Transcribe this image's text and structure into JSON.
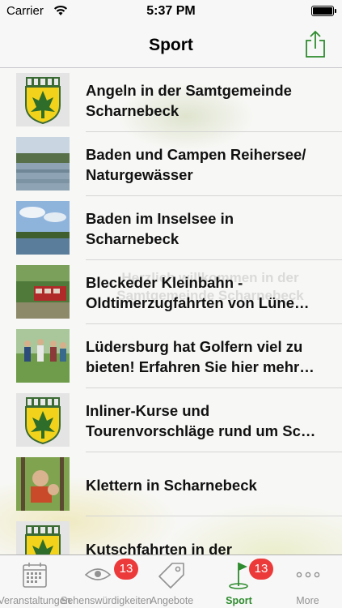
{
  "status_bar": {
    "carrier": "Carrier",
    "time": "5:37 PM"
  },
  "nav": {
    "title": "Sport"
  },
  "background_text": "Herzlich willkommen in der Samtgemeinde Scharnebeck",
  "list": {
    "items": [
      {
        "label": "Angeln in der Samtgemeinde Scharnebeck",
        "thumb": "coat-of-arms"
      },
      {
        "label": "Baden und Campen Reihersee/ Naturgewässer",
        "thumb": "lake-photo"
      },
      {
        "label": "Baden im Inselsee in Scharnebeck",
        "thumb": "lake-sky-photo"
      },
      {
        "label": "Bleckeder Kleinbahn - Oldtimerzugfahrten von Lüne…",
        "thumb": "train-photo"
      },
      {
        "label": "Lüdersburg hat Golfern viel zu bieten! Erfahren Sie hier mehr…",
        "thumb": "golfers-photo"
      },
      {
        "label": "Inliner-Kurse und Tourenvorschläge rund um Sc…",
        "thumb": "coat-of-arms"
      },
      {
        "label": "Klettern in Scharnebeck",
        "thumb": "climbing-photo"
      },
      {
        "label": "Kutschfahrten in der",
        "thumb": "coat-of-arms"
      }
    ]
  },
  "tab_bar": {
    "tabs": [
      {
        "label": "Veranstaltungen",
        "icon": "calendar-icon",
        "badge": ""
      },
      {
        "label": "Sehenswürdigkeiten",
        "icon": "eye-icon",
        "badge": "13"
      },
      {
        "label": "Angebote",
        "icon": "tag-icon",
        "badge": ""
      },
      {
        "label": "Sport",
        "icon": "golf-flag-icon",
        "badge": "13"
      },
      {
        "label": "More",
        "icon": "more-dots-icon",
        "badge": ""
      }
    ],
    "active": "Sport"
  },
  "colors": {
    "accent": "#2e8b2e",
    "badge": "#ec3a3a",
    "inactive": "#929292"
  }
}
